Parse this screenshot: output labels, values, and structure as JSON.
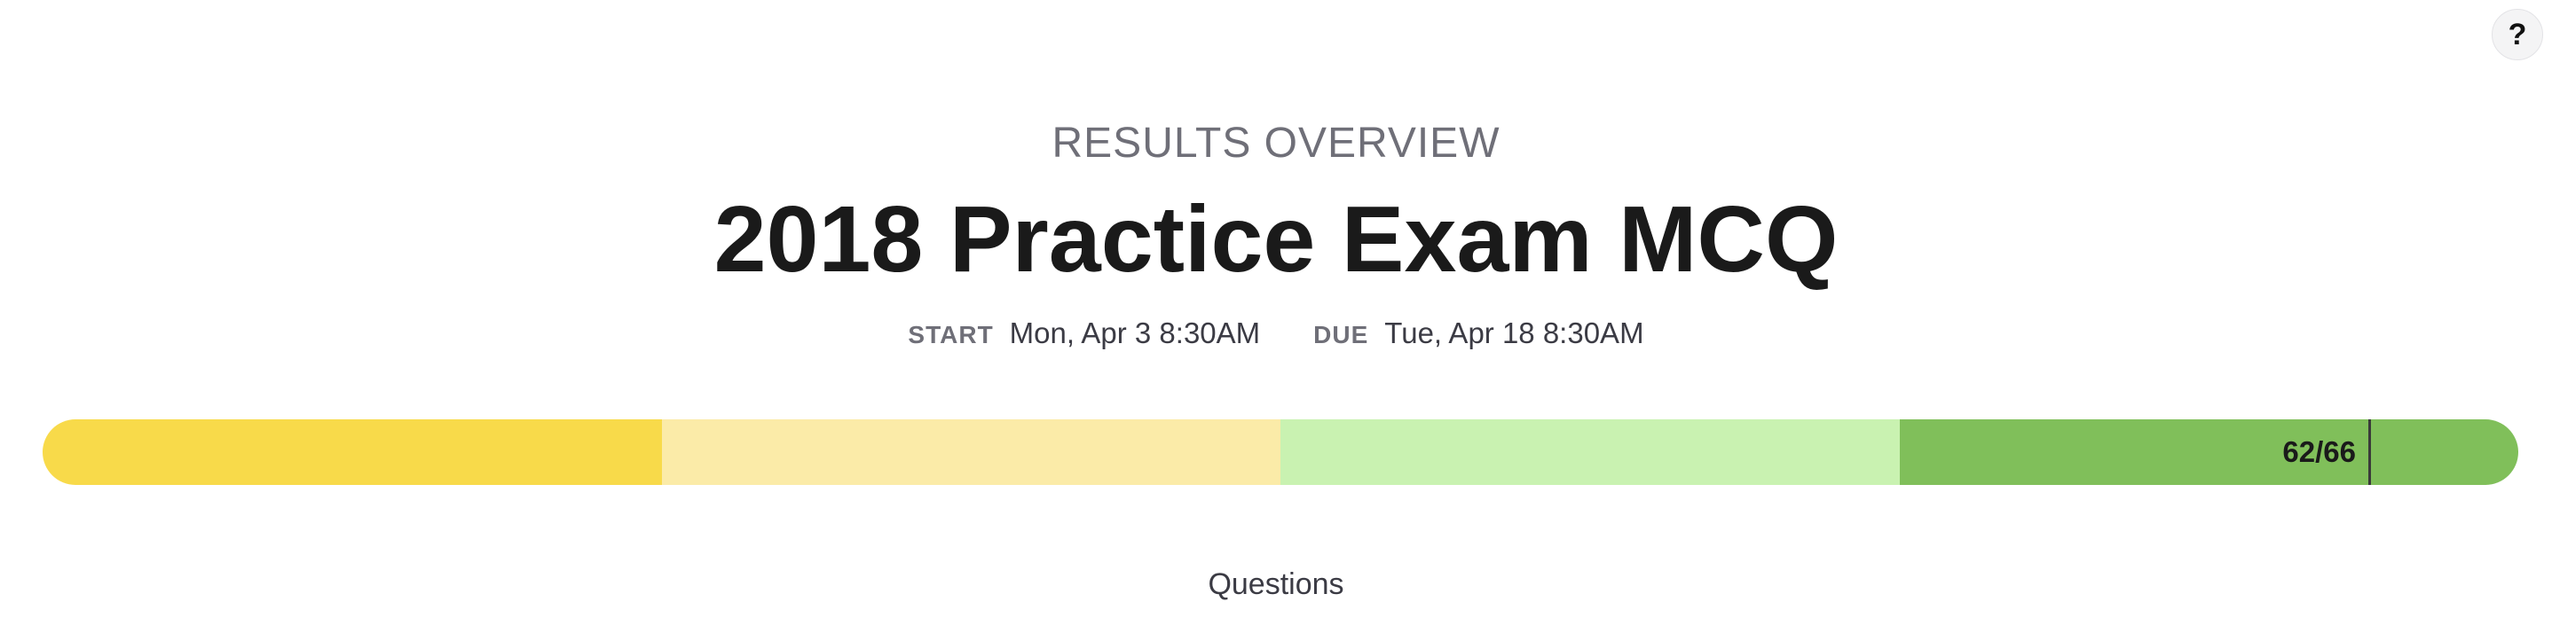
{
  "help": {
    "label": "?"
  },
  "header": {
    "overview_label": "RESULTS OVERVIEW",
    "title": "2018 Practice Exam MCQ"
  },
  "dates": {
    "start_key": "START",
    "start_value": "Mon, Apr 3 8:30AM",
    "due_key": "DUE",
    "due_value": "Tue, Apr 18 8:30AM"
  },
  "score": {
    "text": "62/66",
    "correct": 62,
    "total": 66
  },
  "progress_bar": {
    "segment_colors": [
      "#f8da4a",
      "#fbeba8",
      "#c9f2b1",
      "#80bf5a"
    ]
  },
  "footer": {
    "questions_label": "Questions"
  }
}
